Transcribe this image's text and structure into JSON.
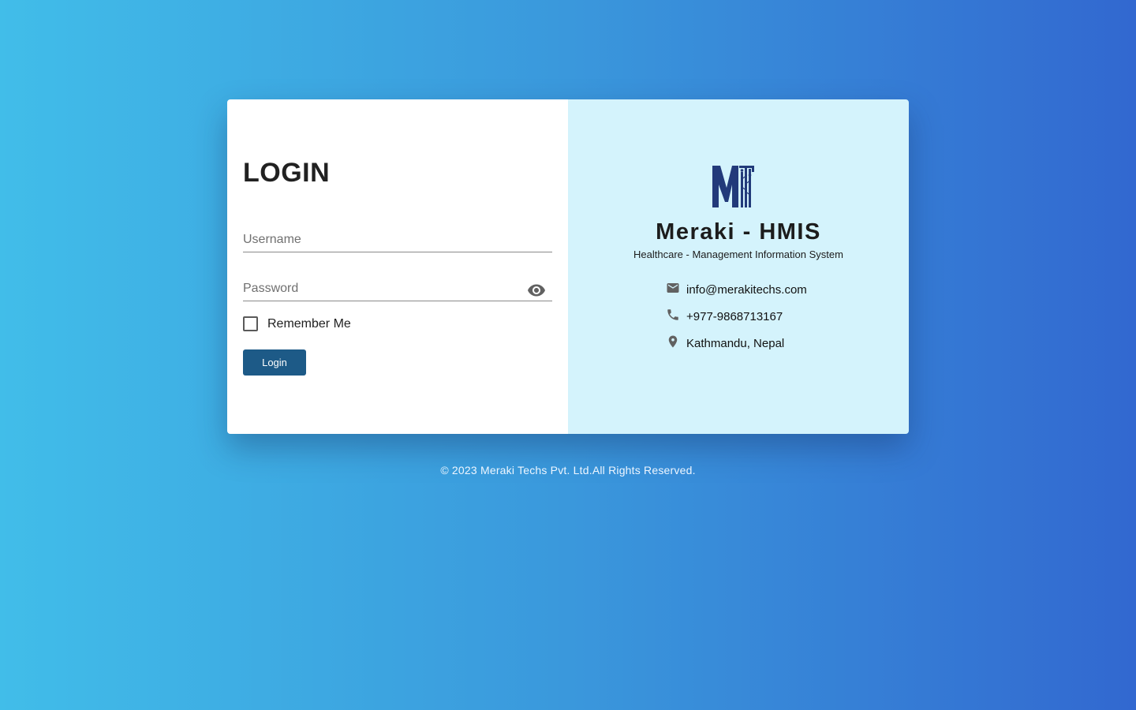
{
  "login_panel": {
    "title": "LOGIN",
    "username_placeholder": "Username",
    "password_placeholder": "Password",
    "remember_label": "Remember Me",
    "login_button_label": "Login",
    "password_toggle_icon": "eye-icon"
  },
  "brand_panel": {
    "logo_icon": "meraki-logo-icon",
    "title": "Meraki - HMIS",
    "subtitle": "Healthcare - Management Information System",
    "contacts": [
      {
        "icon": "mail-icon",
        "text": "info@merakitechs.com"
      },
      {
        "icon": "phone-icon",
        "text": "+977-9868713167"
      },
      {
        "icon": "location-pin-icon",
        "text": "Kathmandu, Nepal"
      }
    ]
  },
  "footer": {
    "text": "© 2023 Meraki Techs Pvt. Ltd.All Rights Reserved."
  },
  "colors": {
    "background_start": "#41bde9",
    "background_end": "#3268d0",
    "brand_panel_bg": "#d4f3fc",
    "login_button_bg": "#1d5a87",
    "logo_color": "#223a7a",
    "icon_color": "#616161"
  }
}
